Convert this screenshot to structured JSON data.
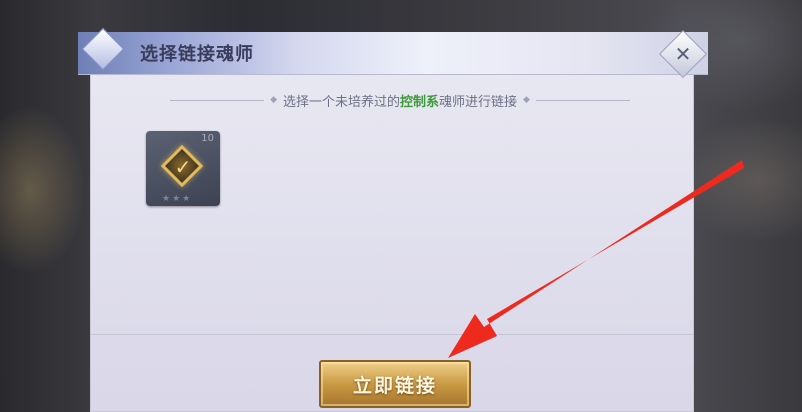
{
  "dialog": {
    "title": "选择链接魂师",
    "close_icon": "close-icon"
  },
  "hint": {
    "before": "选择一个未培养过的",
    "highlight": "控制系",
    "after": "魂师进行链接",
    "highlight_color": "#3e9a3c"
  },
  "card": {
    "level": "10",
    "icon": "control-type-emblem-icon",
    "stars": "★★★"
  },
  "action": {
    "confirm_label": "立即链接"
  },
  "annotation": {
    "icon": "red-arrow-icon",
    "color": "#ee2a1e"
  }
}
